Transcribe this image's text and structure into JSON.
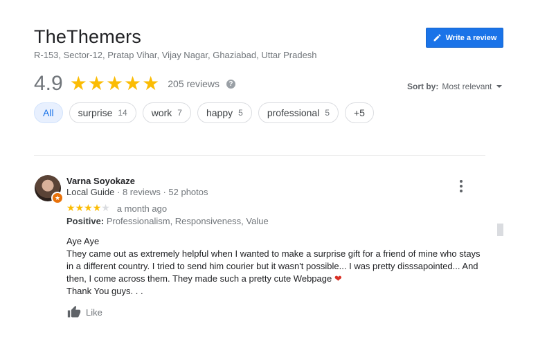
{
  "business": {
    "name": "TheThemers",
    "address": "R-153, Sector-12, Pratap Vihar, Vijay Nagar, Ghaziabad, Uttar Pradesh",
    "rating": "4.9",
    "rating_stars": 5,
    "reviews_label": "205 reviews",
    "help_glyph": "?"
  },
  "write_review": {
    "label": "Write a review",
    "icon": "pencil-icon"
  },
  "sort": {
    "label": "Sort by:",
    "value": "Most relevant"
  },
  "chips": [
    {
      "label": "All",
      "count": ""
    },
    {
      "label": "surprise",
      "count": "14"
    },
    {
      "label": "work",
      "count": "7"
    },
    {
      "label": "happy",
      "count": "5"
    },
    {
      "label": "professional",
      "count": "5"
    },
    {
      "label": "+5",
      "count": ""
    }
  ],
  "review": {
    "name": "Varna Soyokaze",
    "role": "Local Guide",
    "meta": " · 8 reviews · 52 photos",
    "stars": 4,
    "time": "a month ago",
    "positive_label": "Positive:",
    "positive_text": "Professionalism, Responsiveness, Value",
    "lines": [
      "Aye Aye",
      "They came out as extremely helpful when I wanted to make a surprise gift for a friend of mine who stays in a different country. I tried to send him courier but it wasn't possible... I was pretty disssapointed... And then, I come across them. They made such a pretty cute Webpage",
      "Thank You guys. . ."
    ],
    "heart_glyph": "❤",
    "like_label": "Like"
  },
  "colors": {
    "accent": "#1a73e8",
    "star": "#fbbc04",
    "badge": "#e8710a"
  }
}
